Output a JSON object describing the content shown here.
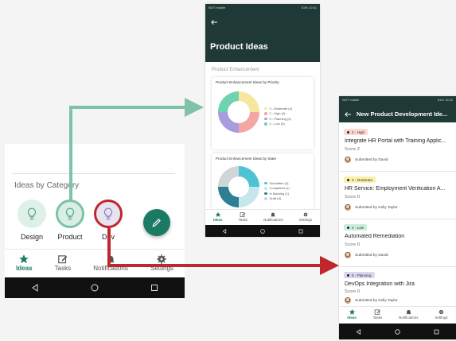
{
  "left_phone": {
    "section_title": "Ideas by Category",
    "categories": [
      {
        "label": "Design",
        "icon": "lightbulb-icon",
        "color": "#dff0e6"
      },
      {
        "label": "Product",
        "icon": "lightbulb-icon",
        "color": "#d8efe6",
        "ring": "#7fc2a6"
      },
      {
        "label": "Dev",
        "icon": "lightbulb-icon",
        "color": "#e7e4f2",
        "ring": "#c0272d"
      }
    ],
    "fab_icon": "pencil-icon",
    "nav": [
      {
        "label": "Ideas",
        "icon": "star-icon"
      },
      {
        "label": "Tasks",
        "icon": "edit-icon"
      },
      {
        "label": "Notifications",
        "icon": "bell-icon"
      },
      {
        "label": "Settings",
        "icon": "gear-icon"
      }
    ]
  },
  "mid_phone": {
    "status_left": "NOT mobile",
    "status_right": "51% 10:31",
    "title": "Product Ideas",
    "section": "Product Enhancement",
    "chart1": {
      "title": "Product Enhancement Ideas by Priority",
      "legend": [
        "3 - Moderate (4)",
        "2 - High (4)",
        "5 - Planning (4)",
        "4 - Low (4)"
      ],
      "colors": [
        "#f6e7a0",
        "#f3a6a3",
        "#a89cde",
        "#6fd3b0"
      ]
    },
    "chart2": {
      "title": "Product Enhancement Ideas by State",
      "legend": [
        "Submitted (4)",
        "Completed (1)",
        "In Backlog (1)",
        "Draft (4)"
      ],
      "colors": [
        "#4fc3d6",
        "#c5e6ec",
        "#2e7f94",
        "#d0d6d8"
      ]
    },
    "nav": [
      {
        "label": "Ideas",
        "icon": "star-icon"
      },
      {
        "label": "Tasks",
        "icon": "edit-icon"
      },
      {
        "label": "Notifications",
        "icon": "bell-icon"
      },
      {
        "label": "Settings",
        "icon": "gear-icon"
      }
    ]
  },
  "right_phone": {
    "status_left": "NOT mobile",
    "status_right": "51% 10:32",
    "title": "New Product Development Ide...",
    "ideas": [
      {
        "badge": "2 - High",
        "badge_color": "#fbd9cf",
        "title": "Integrate HR Portal with Training Applic...",
        "score_label": "Score",
        "score": "2",
        "submitter": "Submitted by David"
      },
      {
        "badge": "3 - Moderate",
        "badge_color": "#fbf0a8",
        "title": "HR Service: Employment Verification A...",
        "score_label": "Score",
        "score": "0",
        "submitter": "Submitted by Kelly Taylor"
      },
      {
        "badge": "4 - Low",
        "badge_color": "#c9eedc",
        "title": "Automated Remediation",
        "score_label": "Score",
        "score": "0",
        "submitter": "Submitted by David"
      },
      {
        "badge": "5 - Planning",
        "badge_color": "#dcd6f3",
        "title": "DevOps Integration with Jira",
        "score_label": "Score",
        "score": "0",
        "submitter": "Submitted by Kelly Taylor"
      }
    ],
    "nav": [
      {
        "label": "Ideas",
        "icon": "star-icon"
      },
      {
        "label": "Tasks",
        "icon": "edit-icon"
      },
      {
        "label": "Notifications",
        "icon": "bell-icon"
      },
      {
        "label": "Settings",
        "icon": "gear-icon"
      }
    ]
  },
  "colors": {
    "accent": "#1b7a64",
    "header": "#1f3a36",
    "arrow_green": "#7fc2a6",
    "arrow_red": "#c0272d"
  }
}
